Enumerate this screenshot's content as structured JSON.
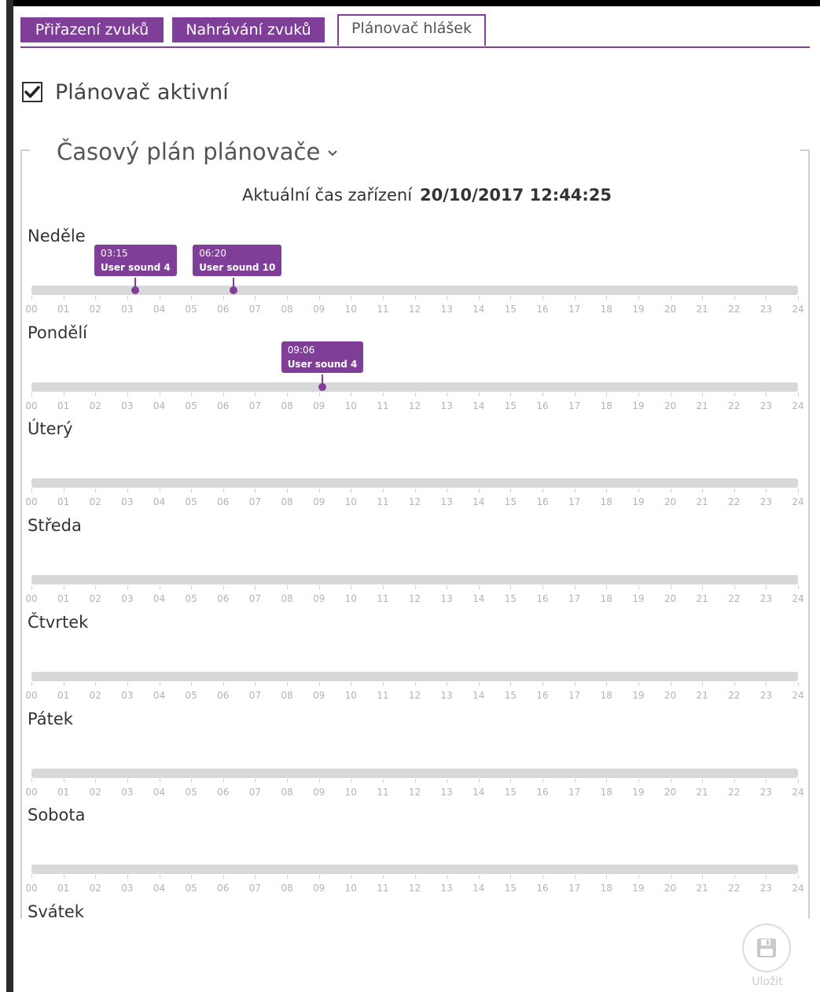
{
  "tabs": [
    {
      "label": "Přiřazení zvuků",
      "active": false
    },
    {
      "label": "Nahrávání zvuků",
      "active": false
    },
    {
      "label": "Plánovač hlášek",
      "active": true
    }
  ],
  "scheduler": {
    "active_label": "Plánovač aktivní",
    "active_checked": true
  },
  "section": {
    "title": "Časový plán plánovače",
    "device_time_label": "Aktuální čas zařízení",
    "device_time_value": "20/10/2017 12:44:25"
  },
  "hour_ticks": [
    "00",
    "01",
    "02",
    "03",
    "04",
    "05",
    "06",
    "07",
    "08",
    "09",
    "10",
    "11",
    "12",
    "13",
    "14",
    "15",
    "16",
    "17",
    "18",
    "19",
    "20",
    "21",
    "22",
    "23",
    "24"
  ],
  "days": [
    {
      "name": "Neděle",
      "events": [
        {
          "time": "03:15",
          "sound": "User sound 4",
          "hour": 3.25
        },
        {
          "time": "06:20",
          "sound": "User sound 10",
          "hour": 6.333
        }
      ]
    },
    {
      "name": "Pondělí",
      "events": [
        {
          "time": "09:06",
          "sound": "User sound 4",
          "hour": 9.1
        }
      ]
    },
    {
      "name": "Úterý",
      "events": []
    },
    {
      "name": "Středa",
      "events": []
    },
    {
      "name": "Čtvrtek",
      "events": []
    },
    {
      "name": "Pátek",
      "events": []
    },
    {
      "name": "Sobota",
      "events": []
    },
    {
      "name": "Svátek",
      "events": []
    }
  ],
  "save": {
    "label": "Uložit"
  },
  "colors": {
    "accent": "#7f3f98",
    "track": "#d8d8d8",
    "tick": "#b3b3b3"
  },
  "icons": {
    "checkbox": "check-icon",
    "expand": "chevron-down-icon",
    "save": "floppy-disk-icon"
  }
}
